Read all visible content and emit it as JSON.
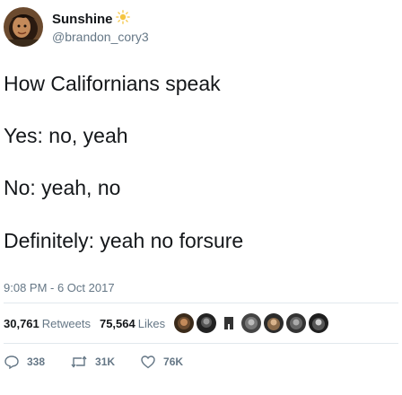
{
  "user": {
    "display_name": "Sunshine",
    "name_emoji": "sun-icon",
    "handle": "@brandon_cory3"
  },
  "tweet": {
    "lines": [
      "How Californians speak",
      "Yes: no, yeah",
      "No: yeah, no",
      "Definitely: yeah no forsure"
    ],
    "timestamp": "9:08 PM - 6 Oct 2017"
  },
  "stats": {
    "retweets_count": "30,761",
    "retweets_label": "Retweets",
    "likes_count": "75,564",
    "likes_label": "Likes"
  },
  "actions": {
    "reply_count": "338",
    "retweet_count": "31K",
    "like_count": "76K"
  },
  "colors": {
    "text": "#14171a",
    "secondary": "#657786",
    "divider": "#e1e8ed",
    "sun": "#f5c542"
  }
}
